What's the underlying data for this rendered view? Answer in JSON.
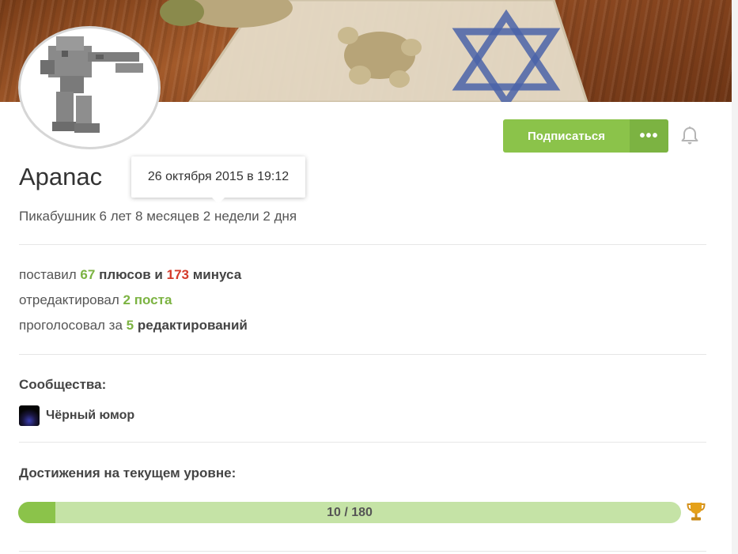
{
  "profile": {
    "username": "Apanac",
    "registered_tooltip": "26 октября 2015 в 19:12",
    "tenure": "Пикабушник 6 лет 8 месяцев 2 недели 2 дня"
  },
  "actions": {
    "subscribe_label": "Подписаться",
    "more_label": "•••",
    "bell_icon": "bell-icon"
  },
  "stats": {
    "votes": {
      "prefix": "поставил",
      "plus_count": "67",
      "plus_label": "плюсов и",
      "minus_count": "173",
      "minus_label": "минуса"
    },
    "edits": {
      "prefix": "отредактировал",
      "count": "2",
      "label": "поста"
    },
    "edit_votes": {
      "prefix": "проголосовал за",
      "count": "5",
      "label": "редактирований"
    }
  },
  "communities": {
    "title": "Сообщества:",
    "items": [
      {
        "name": "Чёрный юмор",
        "icon": "black-humor-community-icon"
      }
    ]
  },
  "achievements": {
    "title": "Достижения на текущем уровне:",
    "progress_text": "10 / 180",
    "progress_fraction": 0.0556,
    "trophy_icon": "trophy-icon"
  },
  "colors": {
    "accent_green": "#8bc34a",
    "accent_green_dark": "#7cb342",
    "minus_red": "#d43b2b",
    "progress_bg": "#c5e3a6"
  }
}
